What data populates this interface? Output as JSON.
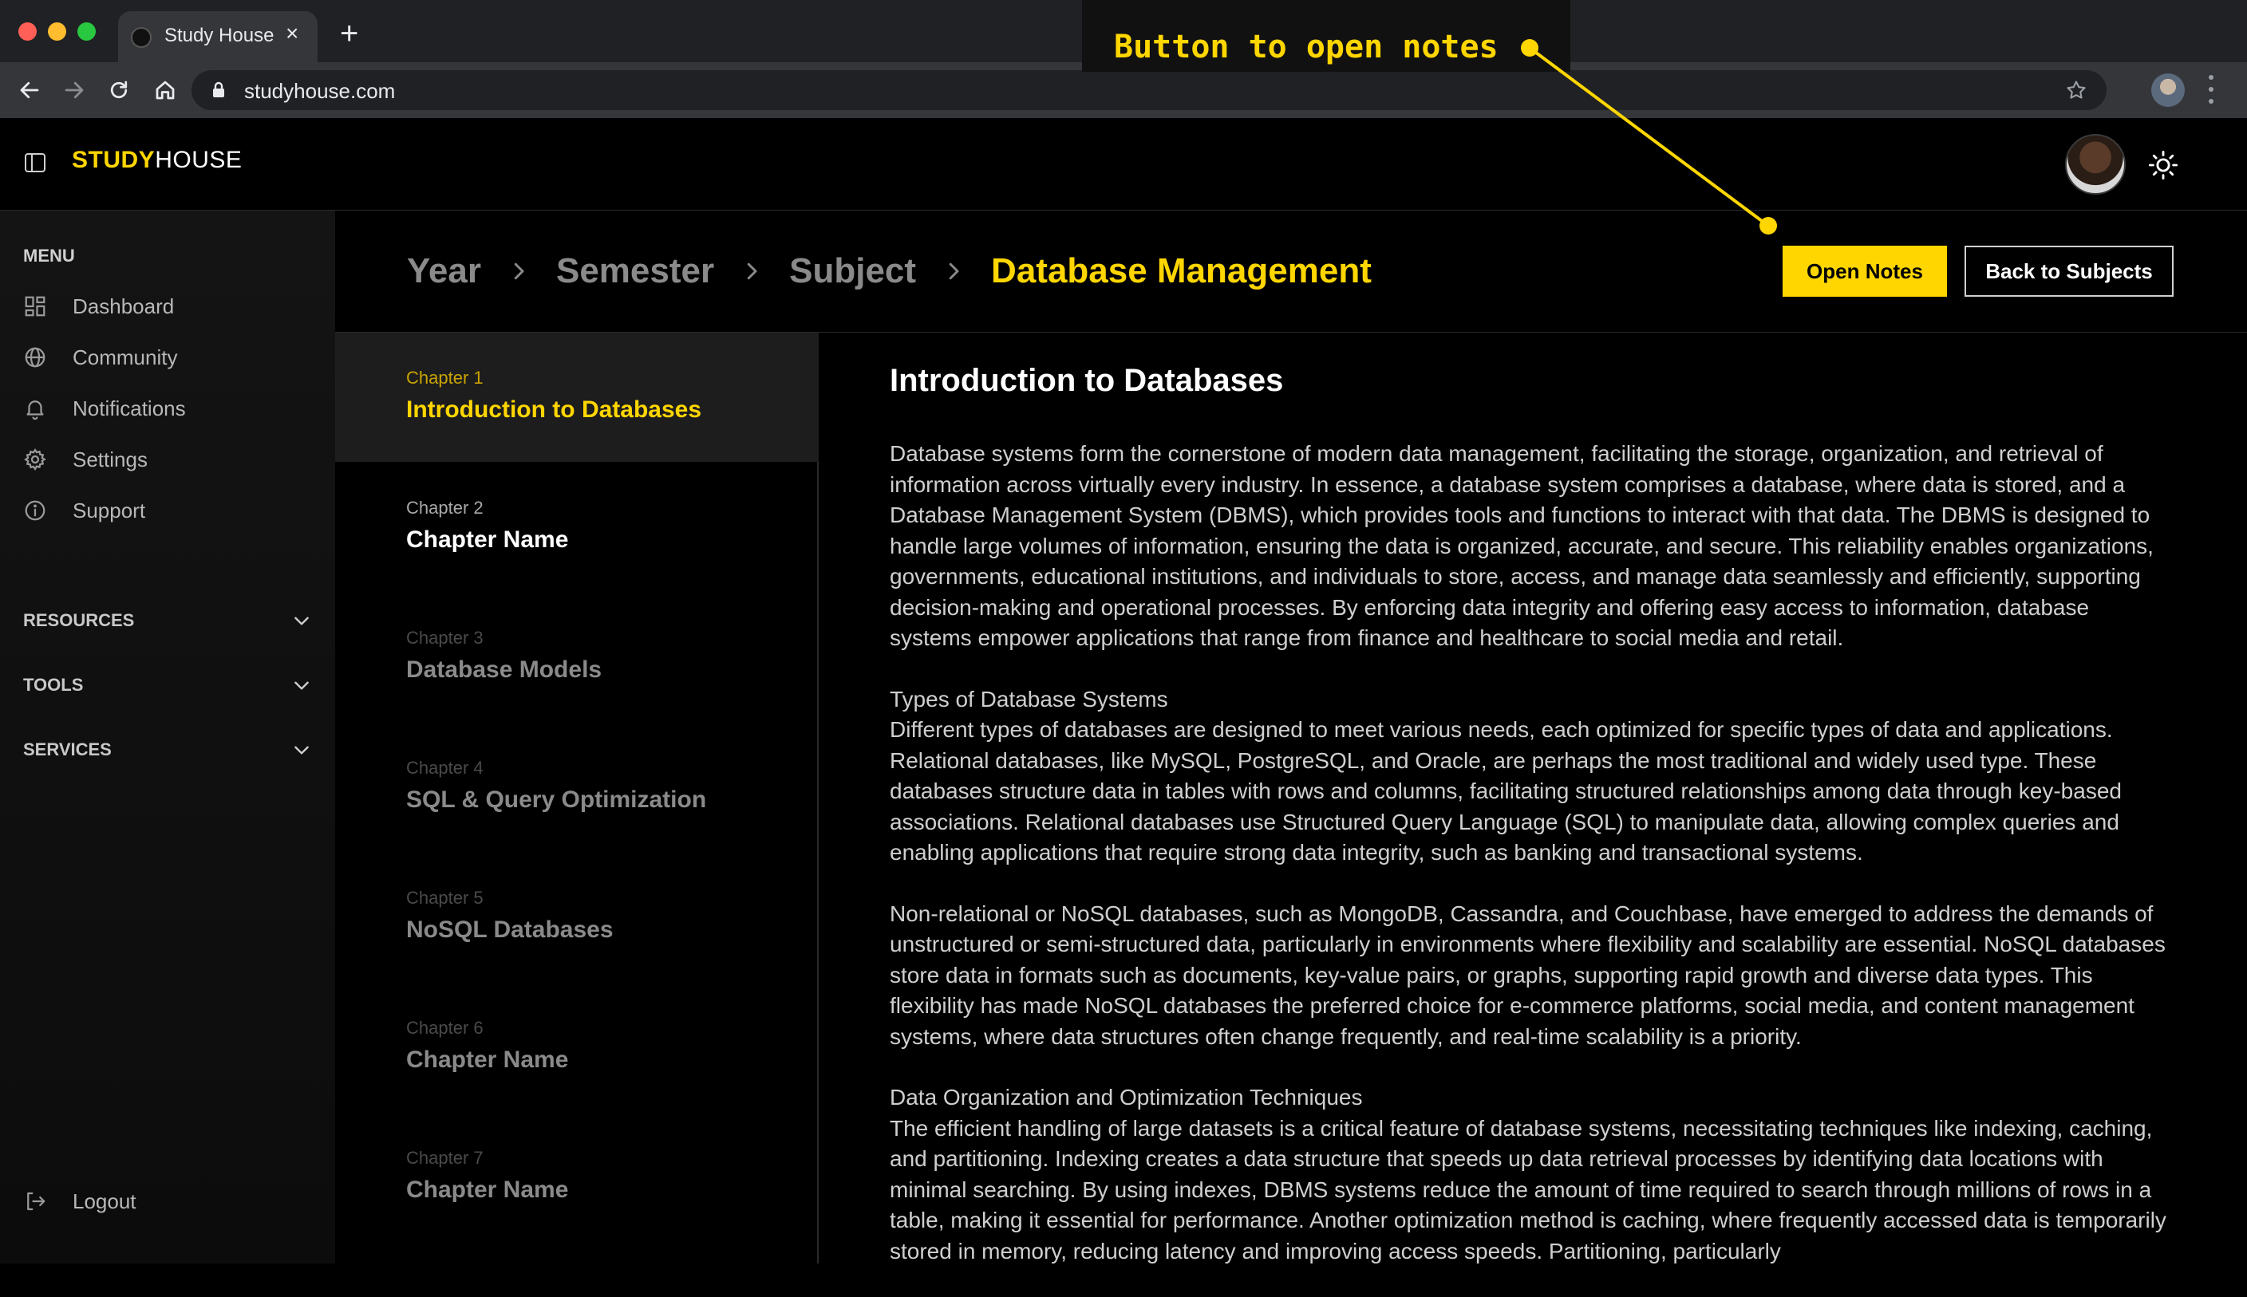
{
  "browser": {
    "tab_title": "Study House",
    "url": "studyhouse.com"
  },
  "app": {
    "logo_primary": "STUDY",
    "logo_secondary": "HOUSE"
  },
  "sidebar": {
    "menu_heading": "MENU",
    "items": [
      {
        "label": "Dashboard",
        "icon": "dashboard-icon"
      },
      {
        "label": "Community",
        "icon": "globe-icon"
      },
      {
        "label": "Notifications",
        "icon": "bell-icon"
      },
      {
        "label": "Settings",
        "icon": "gear-icon"
      },
      {
        "label": "Support",
        "icon": "info-icon"
      }
    ],
    "sections": [
      {
        "label": "RESOURCES"
      },
      {
        "label": "TOOLS"
      },
      {
        "label": "SERVICES"
      }
    ],
    "logout_label": "Logout"
  },
  "breadcrumb": {
    "items": [
      "Year",
      "Semester",
      "Subject"
    ],
    "current": "Database Management"
  },
  "actions": {
    "open_notes": "Open Notes",
    "back_to_subjects": "Back to Subjects"
  },
  "chapters": [
    {
      "number": "Chapter 1",
      "name": "Introduction to Databases",
      "active": true
    },
    {
      "number": "Chapter 2",
      "name": "Chapter Name",
      "active": false
    },
    {
      "number": "Chapter 3",
      "name": "Database Models",
      "active": false
    },
    {
      "number": "Chapter 4",
      "name": "SQL & Query Optimization",
      "active": false
    },
    {
      "number": "Chapter 5",
      "name": "NoSQL Databases",
      "active": false
    },
    {
      "number": "Chapter 6",
      "name": "Chapter Name",
      "active": false
    },
    {
      "number": "Chapter 7",
      "name": "Chapter Name",
      "active": false
    }
  ],
  "content": {
    "title": "Introduction to Databases",
    "paragraphs": [
      {
        "heading": "",
        "text": "Database systems form the cornerstone of modern data management, facilitating the storage, organization, and retrieval of information across virtually every industry. In essence, a database system comprises a database, where data is stored, and a Database Management System (DBMS), which provides tools and functions to interact with that data. The DBMS is designed to handle large volumes of information, ensuring the data is organized, accurate, and secure. This reliability enables organizations, governments, educational institutions, and individuals to store, access, and manage data seamlessly and efficiently, supporting decision-making and operational processes. By enforcing data integrity and offering easy access to information, database systems empower applications that range from finance and healthcare to social media and retail."
      },
      {
        "heading": "Types of Database Systems",
        "text": "Different types of databases are designed to meet various needs, each optimized for specific types of data and applications. Relational databases, like MySQL, PostgreSQL, and Oracle, are perhaps the most traditional and widely used type. These databases structure data in tables with rows and columns, facilitating structured relationships among data through key-based associations. Relational databases use Structured Query Language (SQL) to manipulate data, allowing complex queries and enabling applications that require strong data integrity, such as banking and transactional systems."
      },
      {
        "heading": "",
        "text": "Non-relational or NoSQL databases, such as MongoDB, Cassandra, and Couchbase, have emerged to address the demands of unstructured or semi-structured data, particularly in environments where flexibility and scalability are essential. NoSQL databases store data in formats such as documents, key-value pairs, or graphs, supporting rapid growth and diverse data types. This flexibility has made NoSQL databases the preferred choice for e-commerce platforms, social media, and content management systems, where data structures often change frequently, and real-time scalability is a priority."
      },
      {
        "heading": "Data Organization and Optimization Techniques",
        "text": "The efficient handling of large datasets is a critical feature of database systems, necessitating techniques like indexing, caching, and partitioning. Indexing creates a data structure that speeds up data retrieval processes by identifying data locations with minimal searching. By using indexes, DBMS systems reduce the amount of time required to search through millions of rows in a table, making it essential for performance. Another optimization method is caching, where frequently accessed data is temporarily stored in memory, reducing latency and improving access speeds. Partitioning, particularly"
      }
    ]
  },
  "annotation": {
    "text": "Button to open notes"
  },
  "colors": {
    "accent": "#ffd600",
    "background": "#000000",
    "sidebar": "#141414"
  }
}
